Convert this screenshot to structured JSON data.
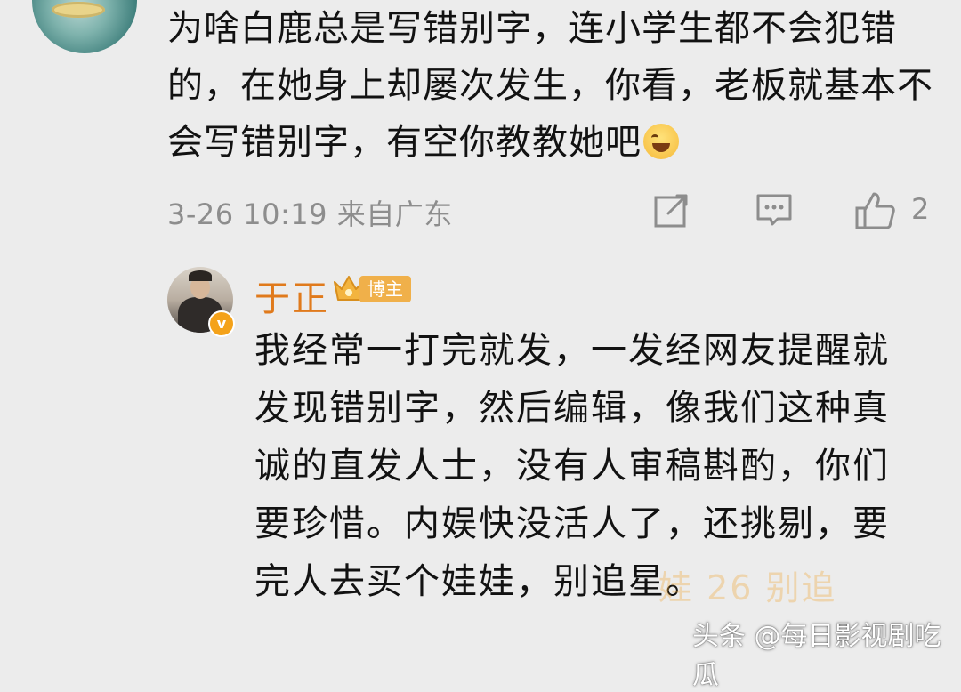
{
  "top_comment": {
    "text": "为啥白鹿总是写错别字，连小学生都不会犯错的，在她身上却屡次发生，你看，老板就基本不会写错别字，有空你教教她吧",
    "emoji": "laughing-crying-emoji",
    "meta": "3-26 10:19 来自广东",
    "like_count": "2"
  },
  "reply": {
    "user_name": "于正",
    "badge_label": "博主",
    "text": "我经常一打完就发，一发经网友提醒就发现错别字，然后编辑，像我们这种真诚的直发人士，没有人审稿斟酌，你们要珍惜。内娱快没活人了，还挑剔，要完人去买个娃娃，别追星。"
  },
  "watermarks": {
    "ghost": "娃 26 别追",
    "source": "头条 @每日影视剧吃瓜"
  },
  "colors": {
    "username": "#e07a1c",
    "meta_gray": "#8d8d8d",
    "badge_gold": "#f0b04a",
    "background": "#ececec"
  }
}
